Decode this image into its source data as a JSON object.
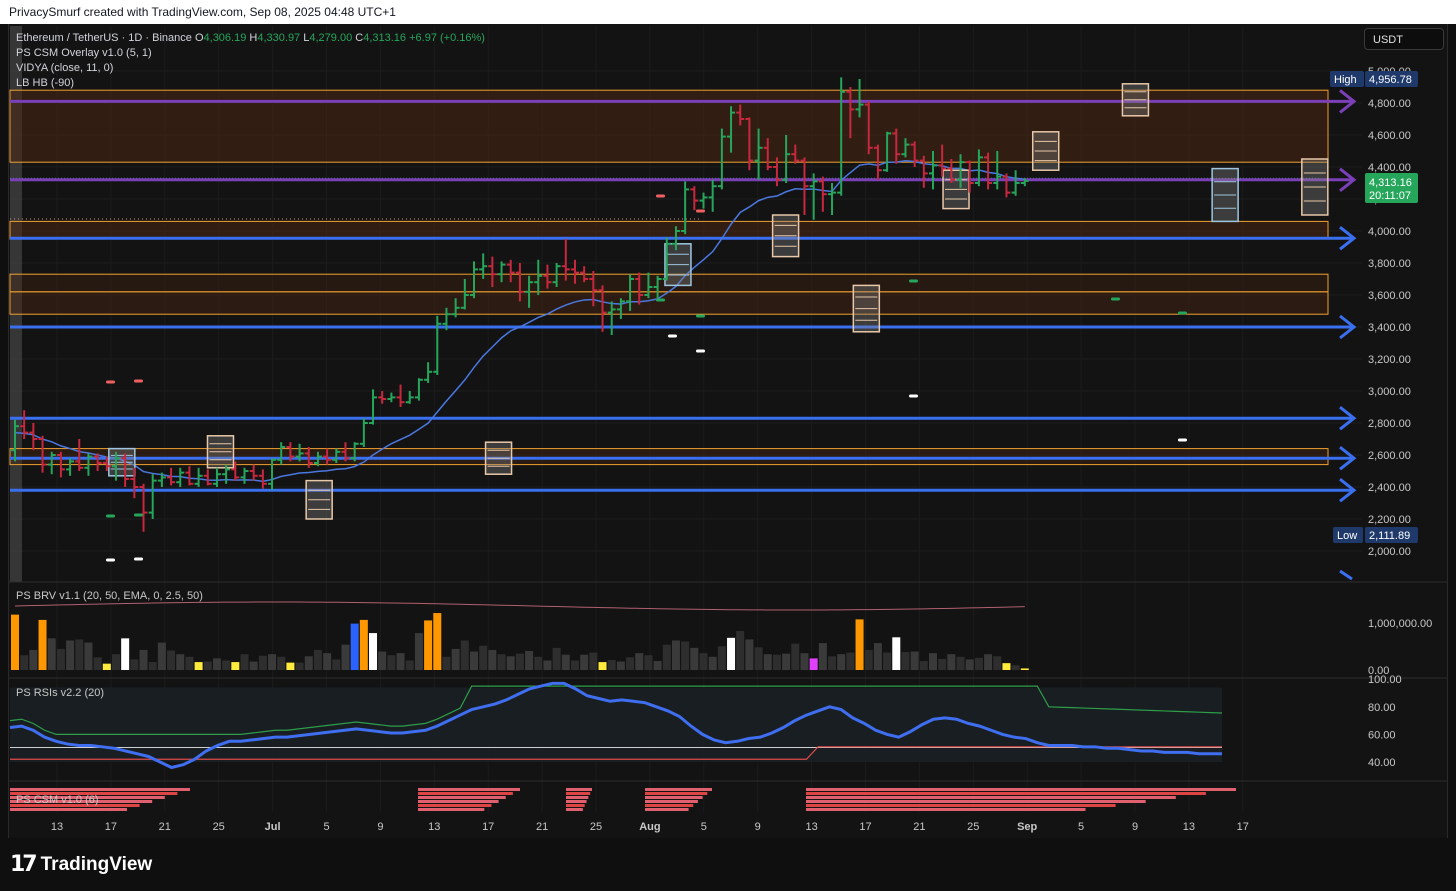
{
  "header": {
    "credit": "PrivacySmurf created with TradingView.com, Sep 08, 2025 04:48 UTC+1"
  },
  "legend": {
    "symbol": "Ethereum / TetherUS · 1D · Binance",
    "o_label": "O",
    "o": "4,306.19",
    "h_label": "H",
    "h": "4,330.97",
    "l_label": "L",
    "l": "4,279.00",
    "c_label": "C",
    "c": "4,313.16",
    "change": "+6.97 (+0.16%)",
    "ind1": "PS CSM Overlay v1.0 (5, 1)",
    "ind2": "VIDYA (close, 11, 0)",
    "ind3": "LB HB (-90)"
  },
  "currency": "USDT",
  "panes": {
    "brv": "PS BRV v1.1 (20, 50, EMA, 0, 2.5, 50)",
    "rsi": "PS RSIs v2.2 (20)",
    "csm": "PS CSM v1.0 (6)"
  },
  "price_badges": {
    "high_label": "High",
    "high": "4,956.78",
    "low_label": "Low",
    "low": "2,111.89",
    "last": "4,313.16",
    "countdown": "20:11:07"
  },
  "brand": {
    "name": "TradingView",
    "mark": "17"
  },
  "colors": {
    "up": "#26a65b",
    "down": "#c8283e",
    "vidya": "#4a78e0",
    "zone_fill": "#4a2612",
    "zone_border": "#f0a030",
    "arrow_blue": "#3a6ff0",
    "arrow_purple": "#7b3fb8"
  },
  "chart_data": {
    "type": "candlestick",
    "y_ticks": [
      "5,000.00",
      "4,800.00",
      "4,600.00",
      "4,400.00",
      "4,200.00",
      "4,000.00",
      "3,800.00",
      "3,600.00",
      "3,400.00",
      "3,200.00",
      "3,000.00",
      "2,800.00",
      "2,600.00",
      "2,400.00",
      "2,200.00",
      "2,000.00"
    ],
    "ylim": [
      1850,
      5100
    ],
    "x_ticks": [
      "13",
      "17",
      "21",
      "25",
      "Jul",
      "5",
      "9",
      "13",
      "17",
      "21",
      "25",
      "Aug",
      "5",
      "9",
      "13",
      "17",
      "21",
      "25",
      "Sep",
      "5",
      "9",
      "13",
      "17"
    ],
    "volume_ticks": [
      "1,000,000.00",
      "0.00"
    ],
    "rsi_ticks": [
      "100.00",
      "80.00",
      "60.00",
      "40.00"
    ],
    "ohlc": [
      [
        2630,
        2820,
        2560,
        2780
      ],
      [
        2780,
        2880,
        2700,
        2740
      ],
      [
        2740,
        2800,
        2630,
        2700
      ],
      [
        2700,
        2720,
        2490,
        2540
      ],
      [
        2540,
        2620,
        2480,
        2600
      ],
      [
        2600,
        2620,
        2460,
        2510
      ],
      [
        2510,
        2580,
        2470,
        2560
      ],
      [
        2560,
        2700,
        2500,
        2520
      ],
      [
        2520,
        2610,
        2470,
        2590
      ],
      [
        2590,
        2610,
        2500,
        2550
      ],
      [
        2550,
        2590,
        2500,
        2530
      ],
      [
        2530,
        2620,
        2440,
        2580
      ],
      [
        2580,
        2610,
        2400,
        2450
      ],
      [
        2450,
        2520,
        2330,
        2400
      ],
      [
        2400,
        2420,
        2120,
        2240
      ],
      [
        2240,
        2480,
        2200,
        2440
      ],
      [
        2440,
        2490,
        2400,
        2460
      ],
      [
        2460,
        2520,
        2410,
        2430
      ],
      [
        2430,
        2520,
        2400,
        2490
      ],
      [
        2490,
        2530,
        2410,
        2420
      ],
      [
        2420,
        2520,
        2400,
        2470
      ],
      [
        2470,
        2510,
        2410,
        2420
      ],
      [
        2420,
        2520,
        2400,
        2480
      ],
      [
        2480,
        2540,
        2420,
        2510
      ],
      [
        2510,
        2560,
        2440,
        2460
      ],
      [
        2460,
        2520,
        2420,
        2500
      ],
      [
        2500,
        2540,
        2440,
        2470
      ],
      [
        2470,
        2510,
        2390,
        2420
      ],
      [
        2420,
        2580,
        2380,
        2570
      ],
      [
        2570,
        2680,
        2540,
        2650
      ],
      [
        2650,
        2680,
        2560,
        2590
      ],
      [
        2590,
        2670,
        2560,
        2610
      ],
      [
        2610,
        2650,
        2520,
        2550
      ],
      [
        2550,
        2620,
        2530,
        2590
      ],
      [
        2590,
        2640,
        2540,
        2570
      ],
      [
        2570,
        2640,
        2550,
        2620
      ],
      [
        2620,
        2680,
        2560,
        2580
      ],
      [
        2580,
        2680,
        2560,
        2670
      ],
      [
        2670,
        2830,
        2650,
        2800
      ],
      [
        2800,
        3010,
        2790,
        2960
      ],
      [
        2960,
        3000,
        2920,
        2950
      ],
      [
        2950,
        2990,
        2930,
        2960
      ],
      [
        2960,
        3040,
        2900,
        2930
      ],
      [
        2930,
        3000,
        2920,
        2960
      ],
      [
        2960,
        3080,
        2940,
        3070
      ],
      [
        3070,
        3180,
        3050,
        3120
      ],
      [
        3120,
        3470,
        3100,
        3420
      ],
      [
        3420,
        3520,
        3380,
        3480
      ],
      [
        3480,
        3580,
        3460,
        3520
      ],
      [
        3520,
        3700,
        3510,
        3600
      ],
      [
        3600,
        3810,
        3580,
        3760
      ],
      [
        3760,
        3860,
        3700,
        3780
      ],
      [
        3780,
        3840,
        3650,
        3730
      ],
      [
        3730,
        3810,
        3680,
        3790
      ],
      [
        3790,
        3820,
        3680,
        3740
      ],
      [
        3740,
        3800,
        3560,
        3620
      ],
      [
        3620,
        3720,
        3520,
        3680
      ],
      [
        3680,
        3820,
        3600,
        3720
      ],
      [
        3720,
        3790,
        3640,
        3680
      ],
      [
        3680,
        3800,
        3650,
        3780
      ],
      [
        3780,
        3950,
        3690,
        3760
      ],
      [
        3760,
        3820,
        3670,
        3740
      ],
      [
        3740,
        3780,
        3680,
        3700
      ],
      [
        3700,
        3750,
        3530,
        3630
      ],
      [
        3630,
        3660,
        3370,
        3490
      ],
      [
        3490,
        3560,
        3350,
        3510
      ],
      [
        3510,
        3580,
        3450,
        3560
      ],
      [
        3560,
        3730,
        3500,
        3700
      ],
      [
        3700,
        3740,
        3540,
        3600
      ],
      [
        3600,
        3740,
        3580,
        3650
      ],
      [
        3650,
        3720,
        3580,
        3700
      ],
      [
        3700,
        3960,
        3690,
        3920
      ],
      [
        3920,
        4030,
        3880,
        4000
      ],
      [
        4000,
        4310,
        3980,
        4260
      ],
      [
        4260,
        4280,
        4130,
        4190
      ],
      [
        4190,
        4240,
        4140,
        4210
      ],
      [
        4210,
        4320,
        4120,
        4280
      ],
      [
        4280,
        4640,
        4260,
        4590
      ],
      [
        4590,
        4780,
        4490,
        4740
      ],
      [
        4740,
        4790,
        4660,
        4700
      ],
      [
        4700,
        4710,
        4380,
        4440
      ],
      [
        4440,
        4640,
        4320,
        4520
      ],
      [
        4520,
        4580,
        4380,
        4400
      ],
      [
        4400,
        4460,
        4280,
        4320
      ],
      [
        4320,
        4600,
        4300,
        4480
      ],
      [
        4480,
        4540,
        4420,
        4440
      ],
      [
        4440,
        4460,
        4100,
        4280
      ],
      [
        4280,
        4360,
        4070,
        4310
      ],
      [
        4310,
        4340,
        4120,
        4230
      ],
      [
        4230,
        4300,
        4100,
        4240
      ],
      [
        4240,
        4960,
        4220,
        4870
      ],
      [
        4870,
        4900,
        4580,
        4760
      ],
      [
        4760,
        4950,
        4710,
        4790
      ],
      [
        4790,
        4810,
        4480,
        4520
      ],
      [
        4520,
        4540,
        4320,
        4380
      ],
      [
        4380,
        4620,
        4370,
        4610
      ],
      [
        4610,
        4640,
        4420,
        4480
      ],
      [
        4480,
        4580,
        4460,
        4540
      ],
      [
        4540,
        4560,
        4400,
        4440
      ],
      [
        4440,
        4470,
        4270,
        4360
      ],
      [
        4360,
        4500,
        4260,
        4410
      ],
      [
        4410,
        4540,
        4340,
        4390
      ],
      [
        4390,
        4450,
        4300,
        4320
      ],
      [
        4320,
        4480,
        4270,
        4430
      ],
      [
        4430,
        4440,
        4240,
        4300
      ],
      [
        4300,
        4510,
        4280,
        4460
      ],
      [
        4460,
        4490,
        4260,
        4300
      ],
      [
        4300,
        4500,
        4260,
        4340
      ],
      [
        4340,
        4360,
        4210,
        4240
      ],
      [
        4240,
        4380,
        4220,
        4300
      ],
      [
        4300,
        4330,
        4280,
        4313
      ]
    ],
    "volume": [
      1050000,
      280000,
      380000,
      950000,
      600000,
      400000,
      560000,
      580000,
      520000,
      240000,
      120000,
      300000,
      600000,
      200000,
      380000,
      150000,
      520000,
      370000,
      300000,
      250000,
      150000,
      160000,
      220000,
      180000,
      150000,
      300000,
      160000,
      270000,
      300000,
      250000,
      140000,
      140000,
      260000,
      380000,
      320000,
      200000,
      480000,
      880000,
      950000,
      700000,
      350000,
      280000,
      320000,
      180000,
      700000,
      940000,
      1080000,
      250000,
      400000,
      560000,
      350000,
      460000,
      380000,
      300000,
      260000,
      310000,
      360000,
      250000,
      180000,
      420000,
      290000,
      180000,
      290000,
      330000,
      150000,
      190000,
      160000,
      240000,
      320000,
      280000,
      170000,
      480000,
      560000,
      540000,
      420000,
      320000,
      250000,
      450000,
      610000,
      740000,
      580000,
      430000,
      300000,
      290000,
      310000,
      500000,
      320000,
      220000,
      510000,
      260000,
      300000,
      330000,
      960000,
      380000,
      510000,
      330000,
      620000,
      340000,
      350000,
      170000,
      320000,
      210000,
      300000,
      250000,
      200000,
      230000,
      300000,
      260000,
      130000,
      90000,
      30000
    ],
    "series": [
      {
        "name": "VIDYA (close, 11, 0)",
        "values": []
      },
      {
        "name": "RSI",
        "values": [
          65,
          66,
          63,
          58,
          55,
          53,
          52,
          52,
          51,
          50,
          48,
          46,
          44,
          40,
          36,
          38,
          42,
          48,
          52,
          55,
          55,
          56,
          57,
          58,
          58,
          59,
          60,
          61,
          62,
          63,
          64,
          63,
          62,
          61,
          61,
          62,
          63,
          66,
          70,
          74,
          78,
          80,
          82,
          85,
          89,
          93,
          95,
          97,
          97,
          93,
          88,
          86,
          84,
          85,
          84,
          83,
          80,
          77,
          73,
          66,
          60,
          56,
          54,
          55,
          57,
          58,
          61,
          65,
          70,
          74,
          77,
          80,
          78,
          72,
          68,
          63,
          60,
          58,
          62,
          67,
          71,
          72,
          71,
          68,
          66,
          63,
          60,
          58,
          57,
          54,
          52,
          52,
          52,
          51,
          51,
          50,
          50,
          49,
          48,
          48,
          47,
          47,
          47,
          46,
          46,
          46
        ]
      }
    ]
  }
}
